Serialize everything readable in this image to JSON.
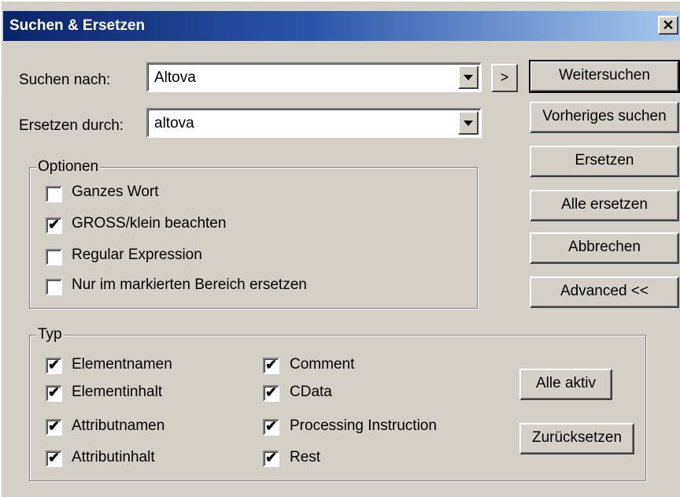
{
  "window": {
    "title": "Suchen & Ersetzen",
    "close_glyph": "✕"
  },
  "find": {
    "label": "Suchen nach:",
    "value": "Altova"
  },
  "replace": {
    "label": "Ersetzen durch:",
    "value": "altova"
  },
  "arrow_button": ">",
  "buttons": {
    "find_next": "Weitersuchen",
    "find_previous": "Vorheriges suchen",
    "replace": "Ersetzen",
    "replace_all": "Alle ersetzen",
    "cancel": "Abbrechen",
    "advanced": "Advanced <<",
    "all_active": "Alle aktiv",
    "reset": "Zurücksetzen"
  },
  "options": {
    "title": "Optionen",
    "items": [
      {
        "label": "Ganzes Wort",
        "checked": false
      },
      {
        "label": "GROSS/klein beachten",
        "checked": true
      },
      {
        "label": "Regular Expression",
        "checked": false
      },
      {
        "label": "Nur im markierten Bereich ersetzen",
        "checked": false
      }
    ]
  },
  "type": {
    "title": "Typ",
    "left": [
      {
        "label": "Elementnamen",
        "checked": true
      },
      {
        "label": "Elementinhalt",
        "checked": true
      },
      {
        "label": "Attributnamen",
        "checked": true
      },
      {
        "label": "Attributinhalt",
        "checked": true
      }
    ],
    "right": [
      {
        "label": "Comment",
        "checked": true
      },
      {
        "label": "CData",
        "checked": true
      },
      {
        "label": "Processing Instruction",
        "checked": true
      },
      {
        "label": "Rest",
        "checked": true
      }
    ]
  },
  "check_glyph": "✔"
}
